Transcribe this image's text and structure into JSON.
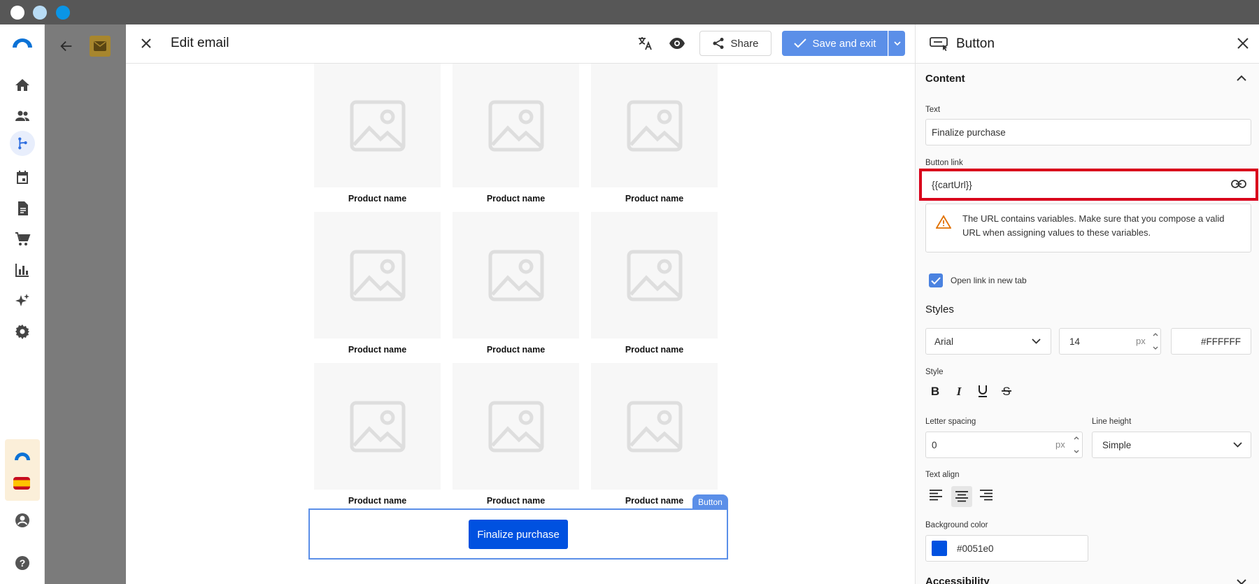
{
  "window": {
    "traffic_lights": [
      "#ffffff",
      "#b8dcf5",
      "#0a95e6"
    ]
  },
  "nav": {
    "items": [
      "home-icon",
      "contacts-icon",
      "automation-icon",
      "calendar-icon",
      "templates-icon",
      "ecommerce-icon",
      "reports-icon",
      "ai-icon",
      "settings-icon"
    ],
    "account_icon": "account-icon",
    "help_icon": "help-icon"
  },
  "editor": {
    "title": "Edit email",
    "share_label": "Share",
    "save_label": "Save and exit",
    "products": [
      "Product name",
      "Product name",
      "Product name",
      "Product name",
      "Product name",
      "Product name",
      "Product name",
      "Product name",
      "Product name"
    ],
    "block_label": "Button",
    "button_text": "Finalize purchase",
    "button_color": "#0051e0",
    "accent": "#5b8fe8"
  },
  "panel": {
    "title": "Button",
    "content_section": "Content",
    "text_label": "Text",
    "text_value": "Finalize purchase",
    "link_label": "Button link",
    "link_value": "{{cartUrl}}",
    "warning": "The URL contains variables. Make sure that you compose a valid URL when assigning values to these variables.",
    "open_new_tab_label": "Open link in new tab",
    "open_new_tab_checked": true,
    "styles_section": "Styles",
    "font_family": "Arial",
    "font_size": "14",
    "font_size_unit": "px",
    "text_color": "#FFFFFF",
    "style_label": "Style",
    "letter_spacing_label": "Letter spacing",
    "letter_spacing_value": "0",
    "letter_spacing_unit": "px",
    "line_height_label": "Line height",
    "line_height_value": "Simple",
    "text_align_label": "Text align",
    "text_align_selected": "center",
    "bg_color_label": "Background color",
    "bg_color_value": "#0051e0",
    "accessibility_section": "Accessibility",
    "highlight_color": "#d9001b"
  }
}
